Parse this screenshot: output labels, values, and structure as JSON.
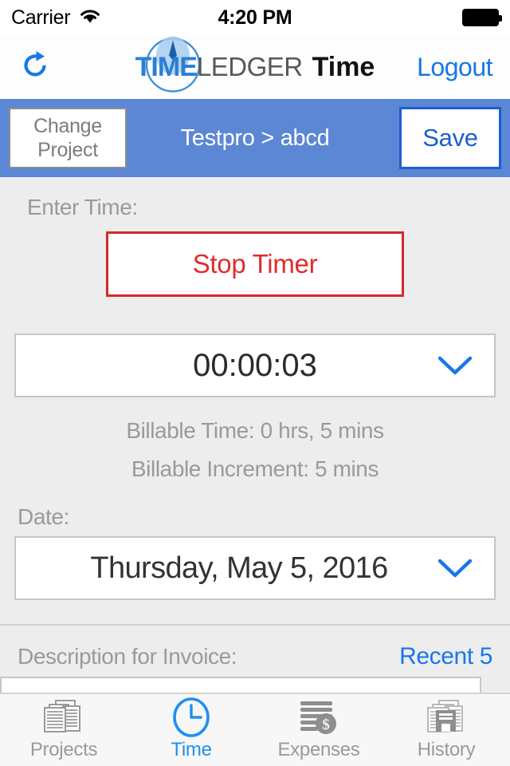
{
  "status_bar": {
    "carrier": "Carrier",
    "wifi_icon": "wifi-icon",
    "time": "4:20 PM",
    "battery_icon": "battery-full-icon"
  },
  "nav_bar": {
    "refresh_icon": "refresh-icon",
    "brand_time": "TIME",
    "brand_ledger": "LEDGER",
    "brand_suffix": "Time",
    "logout_label": "Logout"
  },
  "project_bar": {
    "change_project_line1": "Change",
    "change_project_line2": "Project",
    "project_path": "Testpro > abcd",
    "save_label": "Save",
    "background_color": "#5b87d4"
  },
  "time_entry": {
    "enter_time_label": "Enter Time:",
    "stop_timer_label": "Stop Timer",
    "stop_timer_color": "#e02b2b",
    "timer_value": "00:00:03",
    "timer_chevron_icon": "chevron-down-icon",
    "billable_time": "Billable Time:  0 hrs, 5 mins",
    "billable_increment": "Billable Increment:  5 mins"
  },
  "date_section": {
    "label": "Date:",
    "value": "Thursday, May 5, 2016",
    "chevron_icon": "chevron-down-icon"
  },
  "description_section": {
    "label": "Description for Invoice:",
    "recent_label": "Recent 5",
    "input_value": "",
    "input_placeholder": ""
  },
  "tab_bar": {
    "active_color": "#1e90f0",
    "inactive_color": "#9a9a9a",
    "tabs": [
      {
        "label": "Projects",
        "icon": "documents-stack-icon",
        "active": false
      },
      {
        "label": "Time",
        "icon": "clock-icon",
        "active": true
      },
      {
        "label": "Expenses",
        "icon": "money-lines-icon",
        "active": false
      },
      {
        "label": "History",
        "icon": "building-archive-icon",
        "active": false
      }
    ]
  }
}
